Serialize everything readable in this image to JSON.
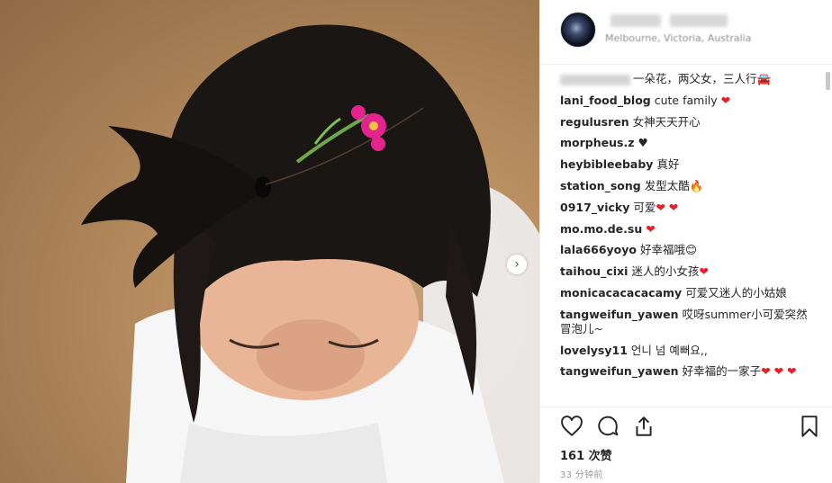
{
  "post": {
    "location": "Melbourne, Victoria, Australia",
    "caption_text": "一朵花，两父女，三人行🚘",
    "next_label": "›",
    "likes": "161 次赞",
    "time_ago": "33 分钟前"
  },
  "comments": [
    {
      "user": "lani_food_blog",
      "text": "cute family ",
      "heart": "❤"
    },
    {
      "user": "regulusren",
      "text": "女神天天开心",
      "heart": ""
    },
    {
      "user": "morpheus.z",
      "text": "♥",
      "heart": ""
    },
    {
      "user": "heybibleebaby",
      "text": "真好",
      "heart": ""
    },
    {
      "user": "station_song",
      "text": "发型太酷🔥",
      "heart": ""
    },
    {
      "user": "0917_vicky",
      "text": "可爱",
      "heart": "❤ ❤"
    },
    {
      "user": "mo.mo.de.su",
      "text": "",
      "heart": "❤"
    },
    {
      "user": "lala666yoyo",
      "text": "好幸福哦😊",
      "heart": ""
    },
    {
      "user": "taihou_cixi",
      "text": "迷人的小女孩",
      "heart": "❤"
    },
    {
      "user": "monicacacacacamy",
      "text": "可爱又迷人的小姑娘",
      "heart": ""
    },
    {
      "user": "tangweifun_yawen",
      "text": "哎呀summer小可爱突然冒泡儿~",
      "heart": ""
    },
    {
      "user": "lovelysy11",
      "text": "언니 넘 예뻐요,,",
      "heart": ""
    },
    {
      "user": "tangweifun_yawen",
      "text": "好幸福的一家子",
      "heart": "❤ ❤ ❤"
    }
  ],
  "icons": {
    "like": "heart-outline-icon",
    "comment": "speech-bubble-icon",
    "share": "share-upload-icon",
    "save": "bookmark-icon"
  },
  "colors": {
    "heart_red": "#ed1c24",
    "text_primary": "#262626",
    "text_secondary": "#8e8e8e"
  }
}
